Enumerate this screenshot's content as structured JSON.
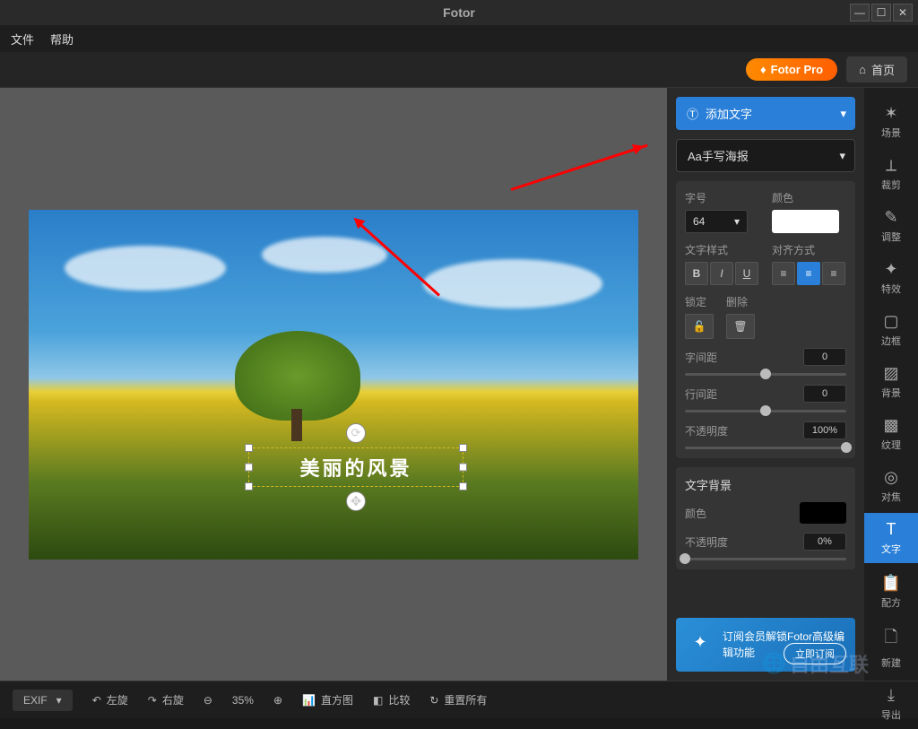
{
  "app": {
    "title": "Fotor"
  },
  "menu": {
    "file": "文件",
    "help": "帮助"
  },
  "topbar": {
    "pro": "Fotor Pro",
    "home": "首页"
  },
  "canvas": {
    "text_content": "美丽的风景"
  },
  "textpanel": {
    "add_text": "添加文字",
    "font_name": "Aa手写海报",
    "font_size_label": "字号",
    "font_size": "64",
    "color_label": "颜色",
    "style_label": "文字样式",
    "align_label": "对齐方式",
    "lock_label": "锁定",
    "delete_label": "删除",
    "letter_spacing_label": "字间距",
    "letter_spacing": "0",
    "line_spacing_label": "行间距",
    "line_spacing": "0",
    "opacity_label": "不透明度",
    "opacity": "100%",
    "bg_section": "文字背景",
    "bg_color_label": "颜色",
    "bg_opacity_label": "不透明度",
    "bg_opacity": "0%"
  },
  "upsell": {
    "text": "订阅会员解锁Fotor高级编辑功能",
    "cta": "立即订阅"
  },
  "tools": {
    "scene": "场景",
    "crop": "裁剪",
    "adjust": "调整",
    "effect": "特效",
    "border": "边框",
    "background": "背景",
    "texture": "纹理",
    "focus": "对焦",
    "text": "文字",
    "preset": "配方",
    "new": "新建",
    "export": "导出"
  },
  "bottombar": {
    "exif": "EXIF",
    "rotate_left": "左旋",
    "rotate_right": "右旋",
    "zoom": "35%",
    "histogram": "直方图",
    "compare": "比较",
    "reset": "重置所有"
  },
  "watermark": "自由互联"
}
